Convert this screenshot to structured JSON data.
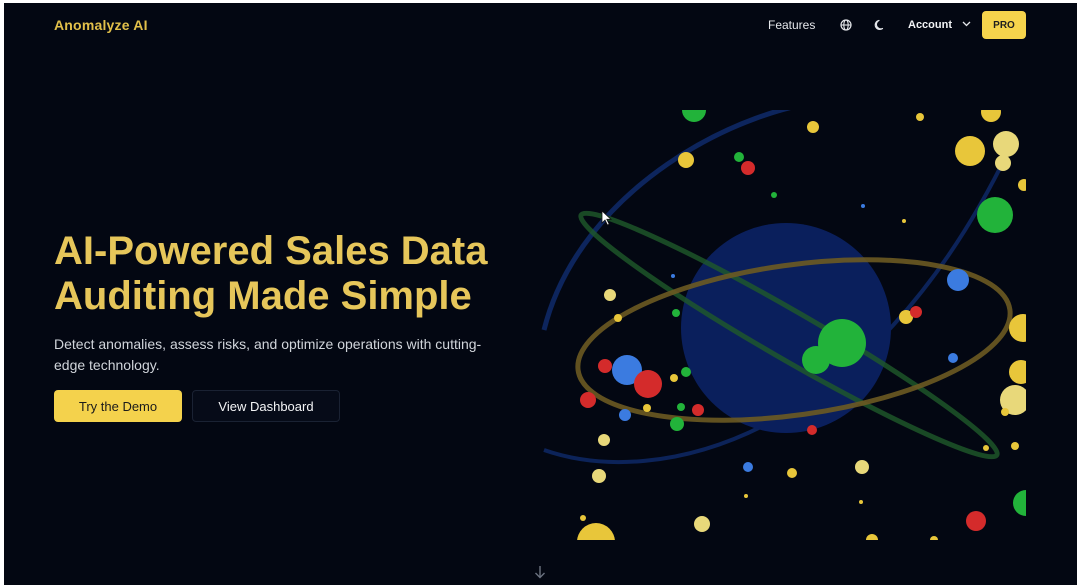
{
  "nav": {
    "brand": "Anomalyze AI",
    "features_label": "Features",
    "account_label": "Account",
    "pro_label": "PRO",
    "icons": [
      "globe-icon",
      "moon-icon",
      "chevron-down-icon"
    ]
  },
  "hero": {
    "title_line1": "AI-Powered Sales Data",
    "title_line2": "Auditing Made Simple",
    "subtitle": "Detect anomalies, assess risks, and optimize operations with cutting-edge technology.",
    "primary_cta": "Try the Demo",
    "secondary_cta": "View Dashboard"
  },
  "colors": {
    "background": "#030712",
    "accent_yellow": "#f4d24c",
    "title_gold": "#e6c65a",
    "sphere_blue": "#0a1f5c",
    "particle_green": "#22b33a",
    "particle_red": "#d42b2b",
    "particle_blue": "#3b7be0",
    "particle_yellow": "#e8c63a"
  },
  "icons": {
    "scroll_hint": "arrow-down-icon"
  }
}
